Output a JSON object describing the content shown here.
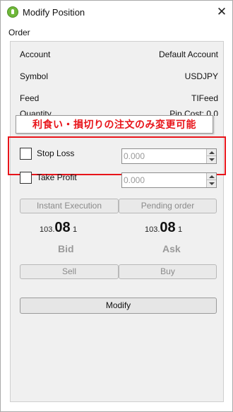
{
  "window": {
    "title": "Modify Position"
  },
  "section": {
    "label": "Order"
  },
  "info": {
    "account_label": "Account",
    "account_value": "Default Account",
    "symbol_label": "Symbol",
    "symbol_value": "USDJPY",
    "feed_label": "Feed",
    "feed_value": "TIFeed",
    "quantity_label": "Quantity",
    "pip_cost_label": "Pip Cost: 0.0"
  },
  "annotation": {
    "text": "利食い・損切りの注文のみ変更可能",
    "color": "#e8141a"
  },
  "stop_loss": {
    "label": "Stop Loss",
    "value": "0.000",
    "checked": false
  },
  "take_profit": {
    "label": "Take Profit",
    "value": "0.000",
    "checked": false
  },
  "execution_tabs": {
    "instant": "Instant Execution",
    "pending": "Pending order"
  },
  "prices": {
    "bid_prefix": "103.",
    "bid_big": "08",
    "bid_suffix": "1",
    "bid_label": "Bid",
    "ask_prefix": "103.",
    "ask_big": "08",
    "ask_suffix": "1",
    "ask_label": "Ask"
  },
  "actions": {
    "sell": "Sell",
    "buy": "Buy",
    "modify": "Modify"
  },
  "icons": {
    "app": "app-icon",
    "close": "close-icon",
    "spin_up": "arrow-up-icon",
    "spin_down": "arrow-down-icon"
  }
}
